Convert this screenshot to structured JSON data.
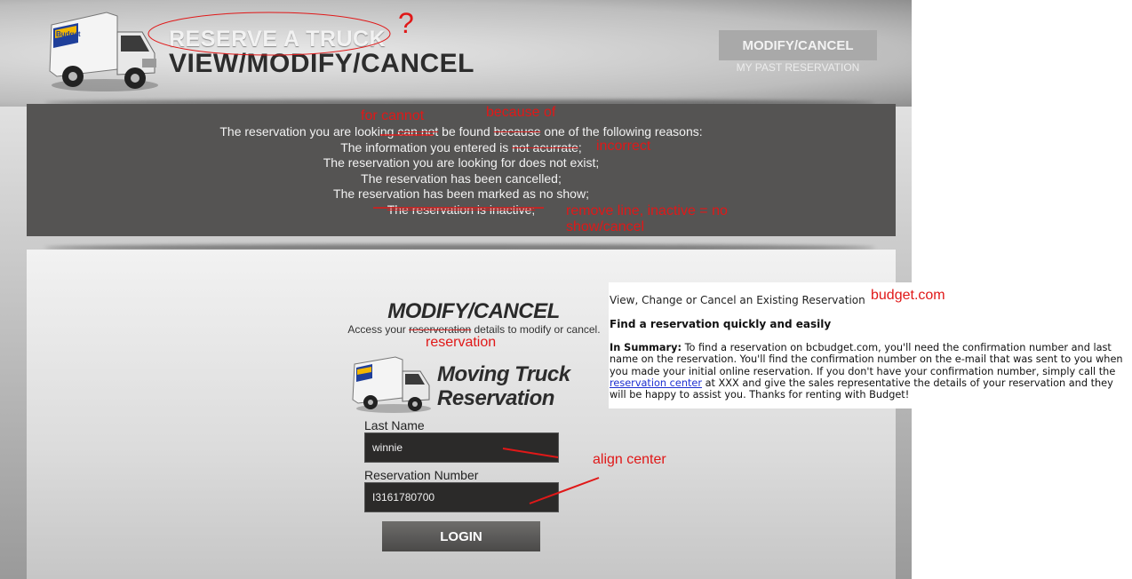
{
  "header": {
    "title_line1": "RESERVE A TRUCK",
    "title_line2": "VIEW/MODIFY/CANCEL",
    "top_button_label": "MODIFY/CANCEL",
    "top_link_label": "MY PAST RESERVATION",
    "logo_brand": "Budget"
  },
  "error": {
    "line1_pre": "The reservation you are looking ",
    "line1_strike1": "can not",
    "line1_mid": " be found ",
    "line1_strike2": "because",
    "line1_post": " one of the following reasons:",
    "line2_pre": "The information you entered is ",
    "line2_strike": "not acurrate",
    "line2_post": ";",
    "line3": "The reservation you are looking for does not exist;",
    "line4": "The reservation has been cancelled;",
    "line5": "The reservation has been marked as no show;",
    "line6": "The reservation is inactive;"
  },
  "form": {
    "title": "MODIFY/CANCEL",
    "subtitle_pre": "Access your ",
    "subtitle_strike": "reserveration",
    "subtitle_post": " details to modify or cancel.",
    "product_line1": "Moving Truck",
    "product_line2": "Reservation",
    "last_name_label": "Last Name",
    "last_name_value": "winnie",
    "res_number_label": "Reservation Number",
    "res_number_value": "I3161780700",
    "login_label": "LOGIN"
  },
  "side_panel": {
    "title": "View, Change or Cancel an Existing Reservation",
    "subtitle": "Find a reservation quickly and easily",
    "summary_label": "In Summary:",
    "summary_text1": " To find a reservation on bcbudget.com, you'll need the confirmation number and last name on the reservation. You'll find the confirmation number on the e-mail that was sent to you when you made your initial online reservation. If you don't have your confirmation number, simply call the ",
    "summary_link": "reservation center",
    "summary_text2": " at XXX and give the sales representative the details of your reservation and they will be happy to assist you. Thanks for renting with Budget!"
  },
  "annotations": {
    "question_mark": "?",
    "for_cannot": "for cannot",
    "because_of": "because of",
    "incorrect": "incorrect",
    "remove_line": "remove line, inactive = no",
    "show_cancel": "show/cancel",
    "reservation": "reservation",
    "align_center": "align center",
    "budget_com": "budget.com"
  },
  "colors": {
    "annotation_red": "#e01818",
    "error_bg": "#555453",
    "input_bg": "#2b2a29",
    "link_blue": "#1d2fd0"
  }
}
